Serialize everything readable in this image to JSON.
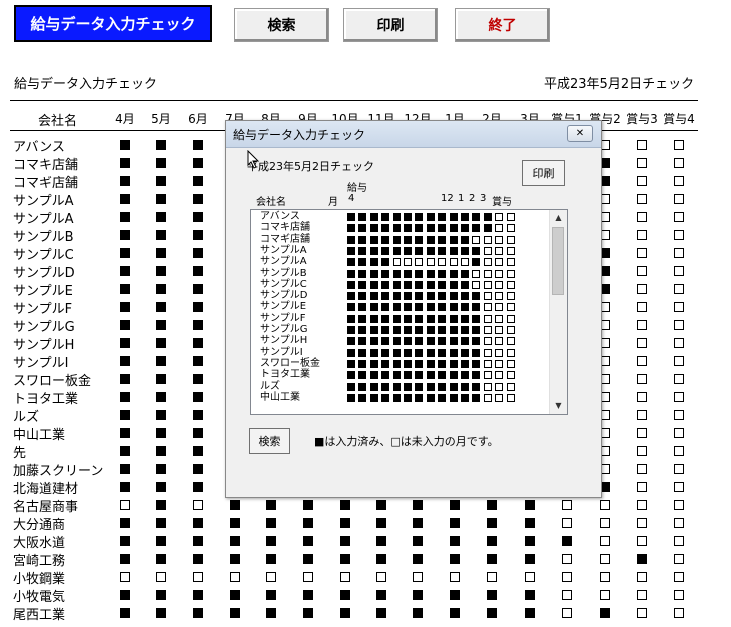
{
  "toolbar": {
    "title_button": "給与データ入力チェック",
    "search": "検索",
    "print": "印刷",
    "exit": "終了"
  },
  "sheet": {
    "title": "給与データ入力チェック",
    "date_check": "平成23年5月2日チェック",
    "company_header": "会社名",
    "months": [
      "4月",
      "5月",
      "6月",
      "7月",
      "8月",
      "9月",
      "10月",
      "11月",
      "12月",
      "1月",
      "2月",
      "3月",
      "賞与1",
      "賞与2",
      "賞与3",
      "賞与4"
    ],
    "companies": [
      "アバンス",
      "コマキ店舗",
      "コマギ店舗",
      "サンプルA",
      "サンプルA",
      "サンプルB",
      "サンプルC",
      "サンプルD",
      "サンプルE",
      "サンプルF",
      "サンプルG",
      "サンプルH",
      "サンプルI",
      "スワロー板金",
      "トヨタ工業",
      "ルズ",
      "中山工業",
      "先",
      "加藤スクリーン",
      "北海道建材",
      "名古屋商事",
      "大分通商",
      "大阪水道",
      "宮崎工務",
      "小牧鋼業",
      "小牧電気",
      "尾西工業"
    ],
    "status": [
      "1111111111100000",
      "1111111111100100",
      "1111111111100100",
      "1111111111100000",
      "1111111111100000",
      "1111111111100000",
      "1111111111100100",
      "1111111111100100",
      "1111111111100100",
      "1111111111100000",
      "1111111111100000",
      "1111111111100000",
      "1111111111100000",
      "1111111111100000",
      "1111111111100000",
      "1111111111100000",
      "1111111111100000",
      "1111111111100000",
      "1111111111100000",
      "1111111111100100",
      "0101111111110000",
      "1111111111110000",
      "1111111111111000",
      "1111111111110010",
      "0000000000000000",
      "1111111111110000",
      "1111111111110100"
    ]
  },
  "dialog": {
    "title": "給与データ入力チェック",
    "close_glyph": "✕",
    "date_check": "平成23年5月2日チェック",
    "print_button": "印刷",
    "company_header": "会社名",
    "month_header": "月",
    "kyuyo_label": "給与",
    "col_4": "4",
    "col_12": "12",
    "col_1": "1",
    "col_2": "2",
    "col_3": "3",
    "bonus_header": "賞与",
    "list_names": [
      "アバンス",
      "コマキ店舗",
      "コマギ店舗",
      "サンプルA",
      "サンプルA",
      "サンプルB",
      "サンプルC",
      "サンプルD",
      "サンプルE",
      "サンプルF",
      "サンプルG",
      "サンプルH",
      "サンプルI",
      "スワロー板金",
      "トヨタ工業",
      "ルズ",
      "中山工業"
    ],
    "list_status": [
      "111111111111100",
      "111111111111100",
      "111111111110000",
      "111111111111000",
      "111100000001000",
      "111111111110000",
      "111111111110000",
      "111111111111000",
      "111111111111000",
      "111111111111000",
      "111111111111000",
      "111111111111000",
      "111111111111000",
      "111111111111000",
      "111111111111000",
      "111111111111000",
      "111111111111000"
    ],
    "search_button": "検索",
    "legend": "■は入力済み、□は未入力の月です。"
  }
}
